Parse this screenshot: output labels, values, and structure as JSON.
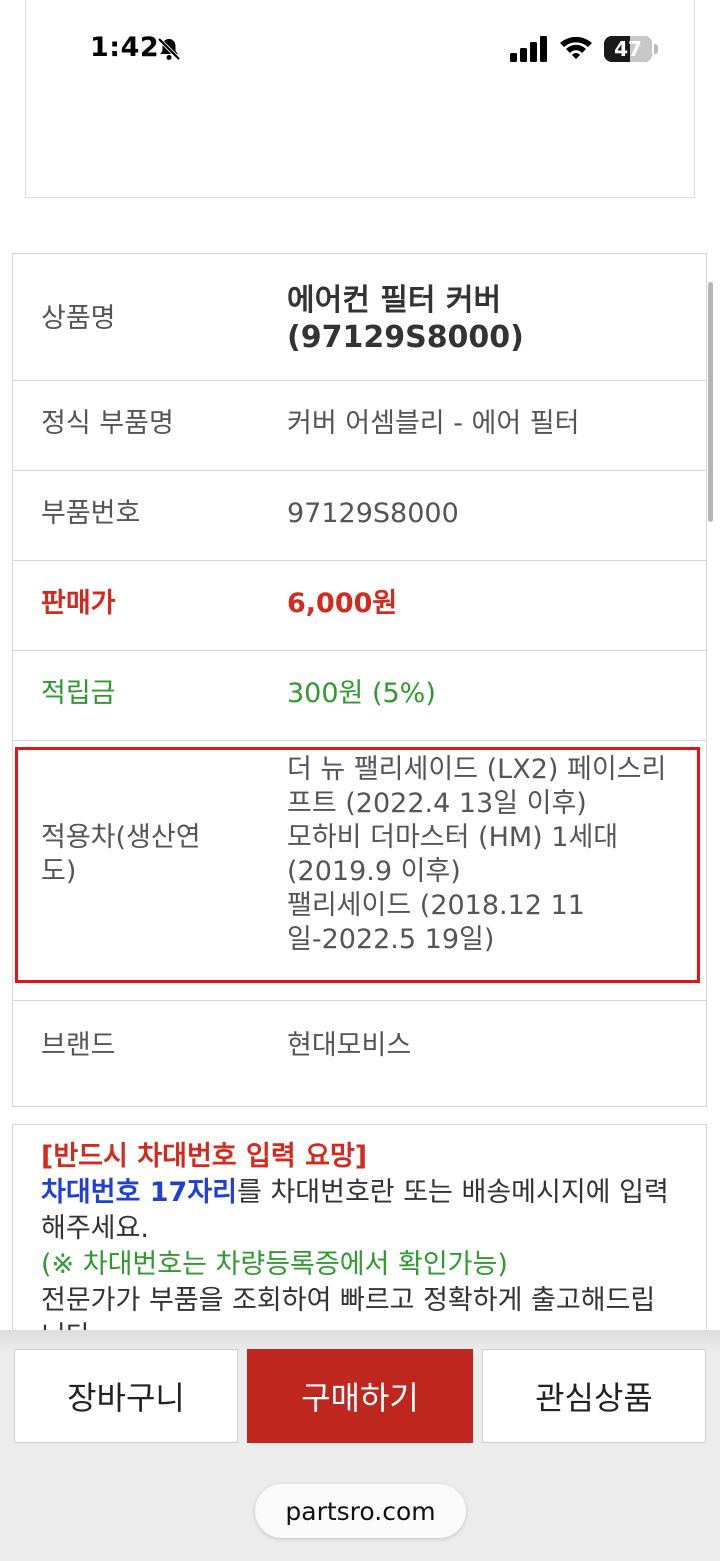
{
  "status_bar": {
    "time": "1:42",
    "battery": "47",
    "icons": [
      "bell-slash-icon",
      "signal-icon",
      "wifi-icon",
      "battery-icon"
    ]
  },
  "product": {
    "rows": {
      "name": {
        "label": "상품명",
        "value_line1": "에어컨 필터 커버",
        "value_line2": "(97129S8000)"
      },
      "standard_name": {
        "label": "정식 부품명",
        "value": "커버 어셈블리 - 에어 필터"
      },
      "part_number": {
        "label": "부품번호",
        "value": "97129S8000"
      },
      "price": {
        "label": "판매가",
        "value": "6,000원"
      },
      "points": {
        "label": "적립금",
        "value": "300원 (5%)"
      },
      "fitment": {
        "label": "적용차(생산연도)",
        "lines": [
          "더 뉴 팰리세이드 (LX2) 페이스리",
          "프트 (2022.4 13일 이후)",
          "모하비 더마스터 (HM) 1세대",
          "(2019.9 이후)",
          "팰리세이드 (2018.12 11",
          "일-2022.5 19일)"
        ]
      },
      "brand": {
        "label": "브랜드",
        "value": "현대모비스"
      }
    }
  },
  "notice": {
    "warning": "[반드시 차대번호 입력 요망]",
    "vin_highlight": "차대번호 17자리",
    "vin_text": "를 차대번호란 또는 배송메시지에 입력해주세요.",
    "check_note": "(※ 차대번호는 차량등록증에서 확인가능)",
    "expert_text": "전문가가 부품을 조회하여 빠르고 정확하게 출고해드립니다."
  },
  "actions": {
    "cart": "장바구니",
    "buy": "구매하기",
    "wishlist": "관심상품"
  },
  "browser": {
    "url": "partsro.com"
  },
  "colors": {
    "price_red": "#d42a1e",
    "points_green": "#2f9a2f",
    "vin_blue": "#1f3fd6",
    "buy_button": "#bf261d",
    "highlight_border": "#e4121b"
  }
}
